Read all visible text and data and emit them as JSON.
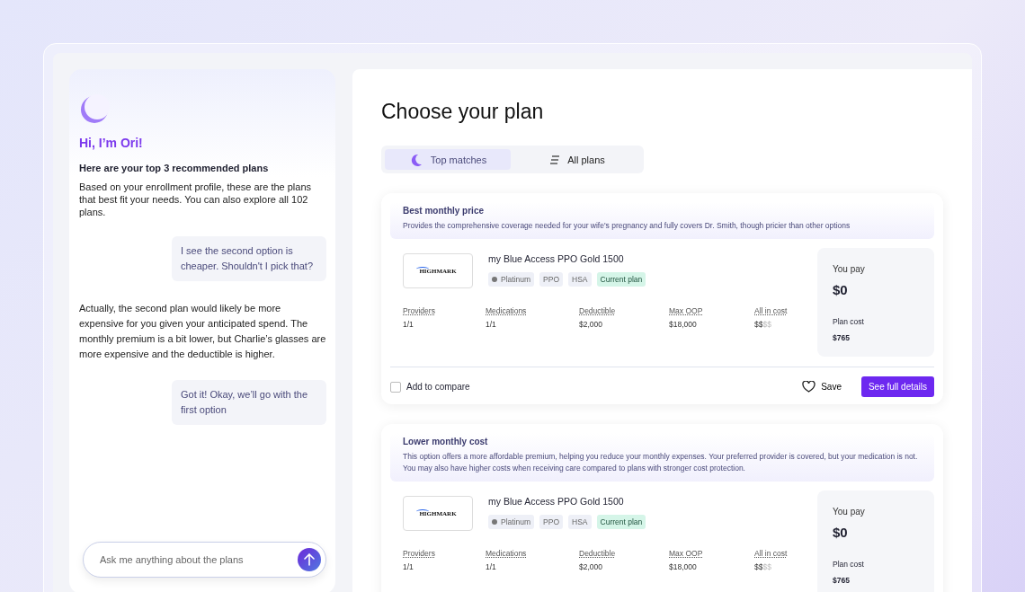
{
  "chat": {
    "greeting": "Hi, I’m Ori!",
    "messages": [
      {
        "kind": "bot",
        "title": "Here are your top 3 recommended plans",
        "text": "Based on your enrollment profile, these are the plans that best fit your needs. You can also explore all 102 plans."
      },
      {
        "kind": "user",
        "text": "I see the second option is cheaper. Shouldn't I pick that?"
      },
      {
        "kind": "bot",
        "text": "Actually, the second plan would likely be more expensive for you given your anticipated spend. The monthly premium is a bit lower, but Charlie’s glasses are more expensive and the deductible is higher."
      },
      {
        "kind": "user",
        "text": "Got it! Okay, we’ll go with the first option"
      }
    ],
    "input": {
      "placeholder": "Ask me anything about the plans"
    }
  },
  "page": {
    "title": "Choose your plan",
    "tabs": [
      {
        "label": "Top matches",
        "selected": true
      },
      {
        "label": "All plans",
        "selected": false
      }
    ],
    "plans": [
      {
        "heading": "Best monthly price",
        "reason": "Provides the comprehensive coverage needed for your wife's pregnancy and fully covers Dr. Smith, though pricier than other options",
        "logo": "HIGHMARK",
        "name": "my Blue Access PPO Gold 1500",
        "tags": [
          {
            "kind": "tier",
            "text": "Platinum"
          },
          {
            "kind": "plain",
            "text": "PPO"
          },
          {
            "kind": "plain",
            "text": "HSA"
          },
          {
            "kind": "current",
            "text": "Current plan"
          }
        ],
        "metrics": [
          {
            "label": "Providers",
            "value": "1/1"
          },
          {
            "label": "Medications",
            "value": "1/1"
          },
          {
            "label": "Deductible",
            "value": "$2,000"
          },
          {
            "label": "Max OOP",
            "value": "$18,000"
          },
          {
            "label": "All in cost",
            "dollars": [
              {
                "text": "$",
                "filled": true
              },
              {
                "text": "$",
                "filled": true
              },
              {
                "text": "$",
                "filled": false
              },
              {
                "text": "$",
                "filled": false
              }
            ]
          }
        ],
        "pay_label": "You pay",
        "pay": "$0",
        "cost_label": "Plan cost",
        "cost": "$765",
        "footer": {
          "compare": "Add to compare",
          "checked": false,
          "save": "Save",
          "details": "See full details"
        }
      },
      {
        "heading": "Lower monthly cost",
        "reason": "This option offers a more affordable premium, helping you reduce your monthly expenses. Your preferred provider is covered, but your medication is not. You may also have higher costs when receiving care compared to plans with stronger cost protection.",
        "logo": "HIGHMARK",
        "name": "my Blue Access PPO Gold 1500",
        "tags": [
          {
            "kind": "tier",
            "text": "Platinum"
          },
          {
            "kind": "plain",
            "text": "PPO"
          },
          {
            "kind": "plain",
            "text": "HSA"
          },
          {
            "kind": "current",
            "text": "Current plan"
          }
        ],
        "metrics": [
          {
            "label": "Providers",
            "value": "1/1"
          },
          {
            "label": "Medications",
            "value": "1/1"
          },
          {
            "label": "Deductible",
            "value": "$2,000"
          },
          {
            "label": "Max OOP",
            "value": "$18,000"
          },
          {
            "label": "All in cost",
            "dollars": [
              {
                "text": "$",
                "filled": true
              },
              {
                "text": "$",
                "filled": true
              },
              {
                "text": "$",
                "filled": false
              },
              {
                "text": "$",
                "filled": false
              }
            ]
          }
        ],
        "pay_label": "You pay",
        "pay": "$0",
        "cost_label": "Plan cost",
        "cost": "$765"
      }
    ]
  }
}
